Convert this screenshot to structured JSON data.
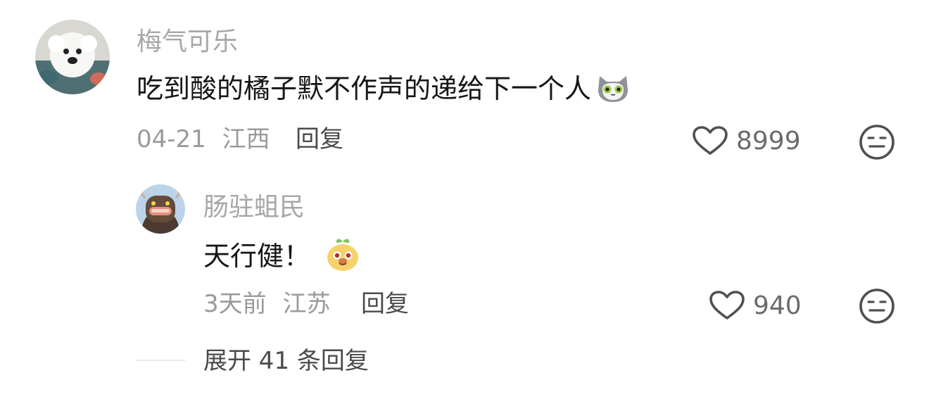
{
  "comment": {
    "username": "梅气可乐",
    "text": "吃到酸的橘子默不作声的递给下一个人",
    "emoji_icon": "cat-face-emoji-icon",
    "date": "04-21",
    "location": "江西",
    "reply_label": "回复",
    "like_count": "8999",
    "dislike_icon": "neutral-face-icon"
  },
  "reply": {
    "username": "肠驻蛆民",
    "text": "天行健！",
    "emoji_icon": "smiling-sprout-emoji-icon",
    "date": "3天前",
    "location": "江苏",
    "reply_label": "回复",
    "like_count": "940",
    "dislike_icon": "neutral-face-icon"
  },
  "expand_label": "展开 41 条回复",
  "colors": {
    "username": "#a7a7a7",
    "meta": "#9a9a9a",
    "text": "#161616",
    "reply_link": "#4b4b4b"
  }
}
